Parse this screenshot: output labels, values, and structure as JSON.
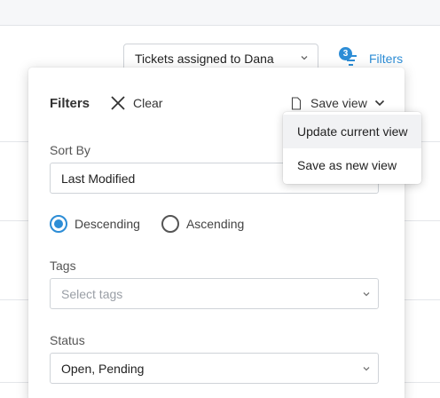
{
  "header": {
    "view_selector_value": "Tickets assigned to Dana",
    "filters_label": "Filters",
    "filters_count": "3"
  },
  "filter_panel": {
    "title": "Filters",
    "clear_label": "Clear",
    "save_view_label": "Save view",
    "sort_by": {
      "label": "Sort By",
      "value": "Last Modified"
    },
    "order": {
      "options": [
        "Descending",
        "Ascending"
      ],
      "selected": "Descending"
    },
    "tags": {
      "label": "Tags",
      "placeholder": "Select tags"
    },
    "status": {
      "label": "Status",
      "value": "Open, Pending"
    }
  },
  "save_view_menu": {
    "items": [
      "Update current view",
      "Save as new view"
    ],
    "highlighted": "Update current view"
  },
  "colors": {
    "accent": "#2d8dd6",
    "panel_bg": "#ffffff",
    "page_bg": "#f6f7f9"
  },
  "icons": {
    "view_selector": "chevron-down-icon",
    "filters": "filter-lines-icon",
    "clear": "close-icon",
    "save_view": "document-icon",
    "save_view_caret": "chevron-down-icon"
  }
}
